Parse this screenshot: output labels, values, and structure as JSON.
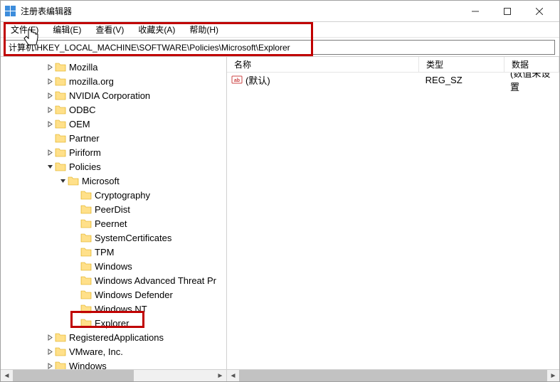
{
  "window_title": "注册表编辑器",
  "menu": {
    "file": "文件(F)",
    "edit": "编辑(E)",
    "view": "查看(V)",
    "favorites": "收藏夹(A)",
    "help": "帮助(H)"
  },
  "address": "计算机\\HKEY_LOCAL_MACHINE\\SOFTWARE\\Policies\\Microsoft\\Explorer",
  "tree": [
    {
      "depth": 3,
      "exp": ">",
      "label": "Mozilla"
    },
    {
      "depth": 3,
      "exp": ">",
      "label": "mozilla.org"
    },
    {
      "depth": 3,
      "exp": ">",
      "label": "NVIDIA Corporation"
    },
    {
      "depth": 3,
      "exp": ">",
      "label": "ODBC"
    },
    {
      "depth": 3,
      "exp": ">",
      "label": "OEM"
    },
    {
      "depth": 3,
      "exp": "",
      "label": "Partner"
    },
    {
      "depth": 3,
      "exp": ">",
      "label": "Piriform"
    },
    {
      "depth": 3,
      "exp": "v",
      "label": "Policies"
    },
    {
      "depth": 4,
      "exp": "v",
      "label": "Microsoft"
    },
    {
      "depth": 5,
      "exp": "",
      "label": "Cryptography"
    },
    {
      "depth": 5,
      "exp": "",
      "label": "PeerDist"
    },
    {
      "depth": 5,
      "exp": "",
      "label": "Peernet"
    },
    {
      "depth": 5,
      "exp": "",
      "label": "SystemCertificates"
    },
    {
      "depth": 5,
      "exp": "",
      "label": "TPM"
    },
    {
      "depth": 5,
      "exp": "",
      "label": "Windows"
    },
    {
      "depth": 5,
      "exp": "",
      "label": "Windows Advanced Threat Pr"
    },
    {
      "depth": 5,
      "exp": "",
      "label": "Windows Defender"
    },
    {
      "depth": 5,
      "exp": "",
      "label": "Windows NT"
    },
    {
      "depth": 5,
      "exp": "",
      "label": "Explorer"
    },
    {
      "depth": 3,
      "exp": ">",
      "label": "RegisteredApplications"
    },
    {
      "depth": 3,
      "exp": ">",
      "label": "VMware, Inc."
    },
    {
      "depth": 3,
      "exp": ">",
      "label": "Windows"
    }
  ],
  "list_header": {
    "name": "名称",
    "type": "类型",
    "data": "数据"
  },
  "list_rows": [
    {
      "name": "(默认)",
      "type": "REG_SZ",
      "data": "(数值未设置"
    }
  ]
}
